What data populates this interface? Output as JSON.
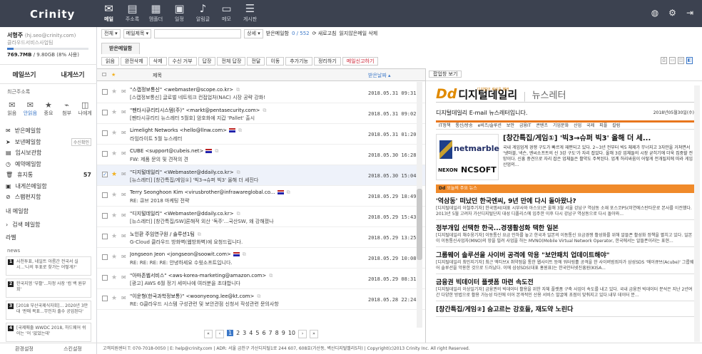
{
  "app": {
    "logo": "Crinity",
    "nav": [
      {
        "label": "메일",
        "icon": "✉",
        "active": true
      },
      {
        "label": "주소록",
        "icon": "▤"
      },
      {
        "label": "멤플더",
        "icon": "▦"
      },
      {
        "label": "일정",
        "icon": "▣"
      },
      {
        "label": "알림글",
        "icon": "♪"
      },
      {
        "label": "메모",
        "icon": "▭"
      },
      {
        "label": "게시판",
        "icon": "☰"
      }
    ],
    "right": [
      "◍",
      "⚙",
      "⇥"
    ]
  },
  "user": {
    "name": "서형주",
    "email": "(hj.seo@crinity.com)",
    "company": "클라우드서비스사업팀",
    "quota": "769.7MB",
    "quota_detail": "/ 9.80GB (8% 사용)",
    "quota_pct": 8
  },
  "write": {
    "compose": "메일쓰기",
    "self": "내게쓰기"
  },
  "recent_label": "최근주소록",
  "quick": [
    {
      "label": "읽음",
      "icon": "✉"
    },
    {
      "label": "안읽음",
      "icon": "✉",
      "badge": "1",
      "active": true
    },
    {
      "label": "중요",
      "icon": "★"
    },
    {
      "label": "첨부",
      "icon": "⌁"
    },
    {
      "label": "나에게",
      "icon": "◫"
    }
  ],
  "folders": [
    {
      "label": "받은메일함",
      "icon": "✉"
    },
    {
      "label": "보낸메일함",
      "icon": "➤",
      "tag": "수신확인"
    },
    {
      "label": "임시보관함",
      "icon": "▤"
    },
    {
      "label": "예약메일함",
      "icon": "◷"
    },
    {
      "label": "휴지통",
      "icon": "🗑",
      "count": "57"
    },
    {
      "label": "내게쓴메일함",
      "icon": "▣"
    },
    {
      "label": "스팸편지함",
      "icon": "⊘"
    }
  ],
  "mybox": "내 메일함",
  "search_box": "검색 메일함",
  "labels": "라벨",
  "news_label": "news",
  "news": [
    {
      "t": "사천투표, 네일트 아름간 전국서 실시...'나의 투표로 찾가는 어떻게?'"
    },
    {
      "t": "한국지엠 '부활'...차정 사장 '컴 백 원부회'"
    },
    {
      "t": "[2018 부산국제식자회]... 2020년 3만대 '판매 목표...무인차 출수 공업된다'"
    },
    {
      "t": "[국제매출 WWDC 2018, 하드웨어 쉬어는 '어 '없었는데'"
    }
  ],
  "side_footer": [
    "환경설정",
    "스킨설정"
  ],
  "toolbar": {
    "filter": "전체",
    "search_field": "메일제목",
    "detail": "상세",
    "unread_label": "받은메일함",
    "unread": "0 / 552",
    "refresh": "새로고침",
    "unread_delete": "읽지않은메일 삭제"
  },
  "tab": "받은메일함",
  "actions": [
    "읽음",
    "완전삭제",
    "삭제",
    "수신 거부",
    "답장",
    "전체 답장",
    "전달",
    "이동",
    "추가기능",
    "정리하기",
    "메일신고하기"
  ],
  "list": {
    "subject_header": "제목",
    "date_header": "받은날짜"
  },
  "mails": [
    {
      "sender": "\"스캡정보통신\" <webmaster@scope.co.kr>",
      "subject": "[스캡정보통신] 글로벌 네트워크 컨접업처(NAC) 시장 공략 강화!",
      "date": "2018.05.31 09:31"
    },
    {
      "sender": "\"펜타시큐리티시스템(주)\" <markt@pentasecurity.com>",
      "subject": "[펜타시큐리티 뉴스레터 5월호] 암호화에 지갑 'Pallet' 출시",
      "date": "2018.05.31 09:02"
    },
    {
      "sender": "Limelight Networks <hello@llnw.com>",
      "subject": "라임라이트 5월 뉴스레터",
      "date": "2018.05.31 01:20",
      "flag": true
    },
    {
      "sender": "CUBE <support@cubeis.net>",
      "subject": "FW: 제품 문의 및 견적의 견",
      "date": "2018.05.30 16:28",
      "flag": true
    },
    {
      "sender": "\"디지털데일리\" <Webmaster@ddaily.co.kr>",
      "subject": "[뉴스레터] [창간특집/게임①] '빅3→슈퍼 빅3' 올해 더 세진다",
      "date": "2018.05.30 15:04",
      "checked": true,
      "starred": true
    },
    {
      "sender": "Terry Seonghoon Kim <virusbrother@infrawareglobal.co...",
      "subject": "RE: 큐브 2018 마케팅 전략",
      "date": "2018.05.29 18:49",
      "flag": true
    },
    {
      "sender": "\"디지털데일리\" <Webmaster@ddaily.co.kr>",
      "subject": "[뉴스레터] [창간특집/SW]론해적 외산 '독주'...국산SW, 왜 강해졌나",
      "date": "2018.05.29 15:43"
    },
    {
      "sender": "노인환 주임연구원 / 솔루션1팀",
      "subject": "G-Cloud 클라우드 방화벽(웹방화벽)에 요청드립니다.",
      "date": "2018.05.29 13:25"
    },
    {
      "sender": "Jongseon Jeon <jongseon@soowit.com>",
      "subject": "RE: RE: RE: RE: 안녕하세요 수윗소프트입니다.",
      "date": "2018.05.29 10:08",
      "flag": true
    },
    {
      "sender": "\"아마존웹서비스\" <aws-korea-marketing@amazon.com>",
      "subject": "[광고] AWS 6월 정기 세미나에 여러분을 초대합니다",
      "date": "2018.05.29 08:31"
    },
    {
      "sender": "\"이운형(한국과학정보통)\" <woonyeong.lee@kt.com>",
      "subject": "RE: G클라우드 시스템 구성관련 및 보안관점 신청서 작성관련 문의사항",
      "date": "2018.05.28 22:24"
    }
  ],
  "pages": [
    "«",
    "‹",
    "1",
    "2",
    "3",
    "4",
    "5",
    "6",
    "7",
    "8",
    "9",
    "10",
    "›",
    "»"
  ],
  "preview": {
    "btn": "팝업창 보기",
    "slogan": "디지털의 새로운 패러",
    "brand": "디지털데일리",
    "brand_mark": "Dd",
    "sub": "뉴스레터",
    "intro": "디지털데일리 E-mail 뉴스레터입니다.",
    "date": "2018년05월30일(수)",
    "nav": [
      "IT정책",
      "통신/방송",
      "e비즈/솔루션",
      "보안",
      "금융IT",
      "콘텐츠",
      "기업문화",
      "산업",
      "국제",
      "피플",
      "칼럼"
    ],
    "feature_title": "[창간특집/게임①] '빅3→슈퍼 빅3' 올해 더 세...",
    "feature_body": "국내 게임업계 경쟁 구도가 빠르게 재편되고 있다. 2~3년 전부터 빅5 체제가 무너지고 3자만을 거쳐면서 '넷마블, 넥슨, 엔씨소프트의 신 3강 구도'가 자리 잡았다. 올해 3강 업체들의 시장 굳히기에 더욱 집중할 전망이다. 신흥 중견으로 자리 잡은 업체들은 활약도 주목된다. 업계 허리싸움이 어떻게 전개될지에 따라 게임산업의...",
    "img": {
      "netmarble": "netmarble",
      "nexon": "NEXON",
      "ncsoft": "NCSOFT"
    },
    "orange": "오늘의 주요 뉴스",
    "articles": [
      {
        "h": "'역삼동' 떠났던 한국엔씨, 9년 만에 다시 돌아왔나?",
        "b": "[디지털데일리 이철주기자] 한국엠씨(대표 시부사와 아스오)은 올해 3월 서울 강남구 역삼동 소재 포스코P5(미연에스탄타운로 본사를 이전했다. 2013년 5월 고려자 가산디지털단지 대성 디폴리스에 입주한 이후 다시 강남구 역삼동으로 다시 돌아와..."
      },
      {
        "h": "정부개입 선택한 한국...경쟁활성화 택한 일본",
        "b": "[디지털데일리 채수웅기자] 이동통신 요금 인하를 놓고 한국과 일본의 이동통신 요금경쟁 활성화를 위해 알뜰폰 활성화 정책을 펼치고 있다. 일본이 이동통신사업자(MNO)의 망을 빌려 사업을 하는 MVNO(Mobile Virtual Network Operator, 한국에서는 알뜰폰이라는 표현..."
      },
      {
        "h": "그룹웨어 솔루션을 사이버 공격에 악용 \"보안패치 업데이트해야\"",
        "b": "[디지털데일리 최민지기자] 최근 액티브X 취약점을 통한 웹사이트 등에 워터링홀 공격을 한 사이버범죄자가 삼성SDS '에이큐브(Acube)' 그룹웨어 솔루션을 악용한 것으로 드러났다. 이에 삼성SDS(대표 홍원표)는 한국인터넷진흥원(KISA..."
      },
      {
        "h": "금융권 빅데이터 플랫폼 마련 속도전",
        "b": "[디지털데일리 이상일기자] 금융권의 빅데이터 활용을 위한 자체 플랫폼 구축 사업이 속도를 내고 있다. 국내 금융권 빅데이터 분석은 지난 2년여 간 다양한 방법으로 활용 가능성 타진에 이어 본격적인 산용 서비스 발굴에 초점이 맞춰지고 있다.내부 데이터 분..."
      },
      {
        "h": "[창간특집/게임②] 숨고르는 강호들, 재도약 노린다",
        "b": ""
      }
    ]
  },
  "footer": "고객지원센터  T: 070-7018-0050  |  E: help@crinity.com  |  ADR: 서울 금천구 가산디지털1로 244 607, 608호(가산동, 벽산디지털밸리5차)  |  Copyright(c)2013 Crinity Inc. All right Reserved."
}
